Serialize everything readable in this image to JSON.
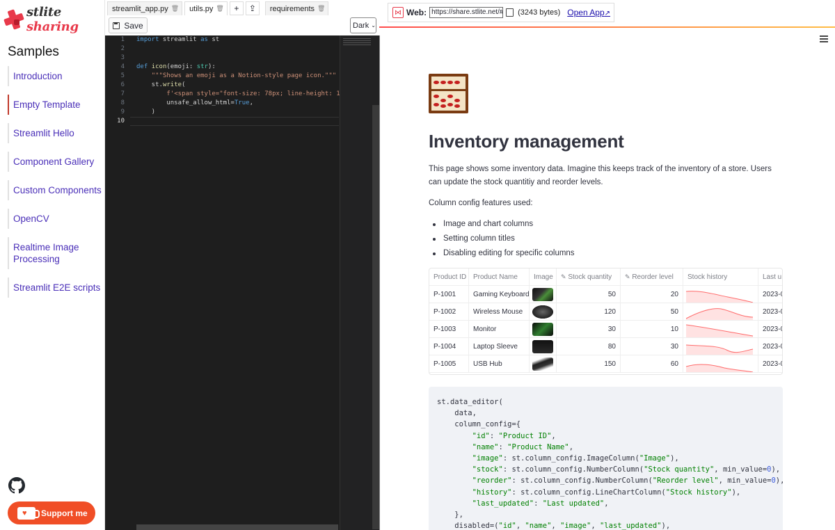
{
  "sidebar": {
    "logo_text_1": "stlite",
    "logo_text_2": "sharing",
    "title": "Samples",
    "items": [
      {
        "label": "Introduction"
      },
      {
        "label": "Empty Template"
      },
      {
        "label": "Streamlit Hello"
      },
      {
        "label": "Component Gallery"
      },
      {
        "label": "Custom Components"
      },
      {
        "label": "OpenCV"
      },
      {
        "label": "Realtime Image Processing"
      },
      {
        "label": "Streamlit E2E scripts"
      }
    ],
    "support_label": "Support me"
  },
  "editor": {
    "tabs": [
      {
        "label": "streamlit_app.py"
      },
      {
        "label": "utils.py"
      },
      {
        "label": "requirements"
      }
    ],
    "add_label": "+",
    "save_label": "Save",
    "theme_value": "Dark",
    "line_numbers": [
      "1",
      "2",
      "3",
      "4",
      "5",
      "6",
      "7",
      "8",
      "9",
      "10"
    ]
  },
  "web": {
    "label": "Web:",
    "url": "https://share.stlite.net/#",
    "bytes": "(3243 bytes)",
    "open_app": "Open App"
  },
  "app": {
    "title": "Inventory management",
    "intro": "This page shows some inventory data. Imagine this keeps track of the inventory of a store. Users can update the stock quantitiy and reorder levels.",
    "features_label": "Column config features used:",
    "bullets": [
      "Image and chart columns",
      "Setting column titles",
      "Disabling editing for specific columns"
    ],
    "table": {
      "headers": [
        "Product ID",
        "Product Name",
        "Image",
        "Stock quantity",
        "Reorder level",
        "Stock history",
        "Last u"
      ],
      "rows": [
        {
          "id": "P-1001",
          "name": "Gaming Keyboard",
          "stock": "50",
          "reorder": "20",
          "last": "2023-0"
        },
        {
          "id": "P-1002",
          "name": "Wireless Mouse",
          "stock": "120",
          "reorder": "50",
          "last": "2023-0"
        },
        {
          "id": "P-1003",
          "name": "Monitor",
          "stock": "30",
          "reorder": "10",
          "last": "2023-0"
        },
        {
          "id": "P-1004",
          "name": "Laptop Sleeve",
          "stock": "80",
          "reorder": "30",
          "last": "2023-0"
        },
        {
          "id": "P-1005",
          "name": "USB Hub",
          "stock": "150",
          "reorder": "60",
          "last": "2023-0"
        }
      ]
    }
  },
  "colors": {
    "accent": "#e8394a",
    "link": "#4a2fb8",
    "support": "#f04e26"
  }
}
